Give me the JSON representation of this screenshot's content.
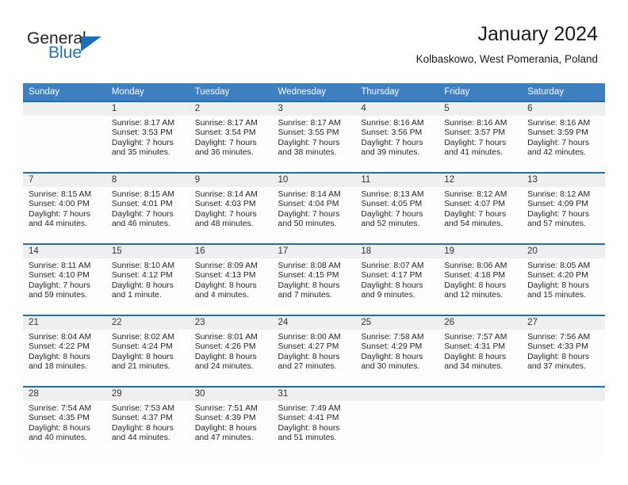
{
  "logo": {
    "word1": "General",
    "word2": "Blue",
    "triangle_color": "#1d70b8",
    "blue_color": "#1d76bd"
  },
  "header": {
    "month_title": "January 2024",
    "location": "Kolbaskowo, West Pomerania, Poland"
  },
  "theme": {
    "header_row_bg": "#3d7fc1",
    "week_separator": "#1d70b8",
    "daynum_band_bg": "#efefef",
    "cell_bg": "#fdfdfd"
  },
  "calendar": {
    "weekday_headers": [
      "Sunday",
      "Monday",
      "Tuesday",
      "Wednesday",
      "Thursday",
      "Friday",
      "Saturday"
    ],
    "weeks": [
      [
        {
          "day": "",
          "detail": ""
        },
        {
          "day": "1",
          "detail": "Sunrise: 8:17 AM\nSunset: 3:53 PM\nDaylight: 7 hours\nand 35 minutes."
        },
        {
          "day": "2",
          "detail": "Sunrise: 8:17 AM\nSunset: 3:54 PM\nDaylight: 7 hours\nand 36 minutes."
        },
        {
          "day": "3",
          "detail": "Sunrise: 8:17 AM\nSunset: 3:55 PM\nDaylight: 7 hours\nand 38 minutes."
        },
        {
          "day": "4",
          "detail": "Sunrise: 8:16 AM\nSunset: 3:56 PM\nDaylight: 7 hours\nand 39 minutes."
        },
        {
          "day": "5",
          "detail": "Sunrise: 8:16 AM\nSunset: 3:57 PM\nDaylight: 7 hours\nand 41 minutes."
        },
        {
          "day": "6",
          "detail": "Sunrise: 8:16 AM\nSunset: 3:59 PM\nDaylight: 7 hours\nand 42 minutes."
        }
      ],
      [
        {
          "day": "7",
          "detail": "Sunrise: 8:15 AM\nSunset: 4:00 PM\nDaylight: 7 hours\nand 44 minutes."
        },
        {
          "day": "8",
          "detail": "Sunrise: 8:15 AM\nSunset: 4:01 PM\nDaylight: 7 hours\nand 46 minutes."
        },
        {
          "day": "9",
          "detail": "Sunrise: 8:14 AM\nSunset: 4:03 PM\nDaylight: 7 hours\nand 48 minutes."
        },
        {
          "day": "10",
          "detail": "Sunrise: 8:14 AM\nSunset: 4:04 PM\nDaylight: 7 hours\nand 50 minutes."
        },
        {
          "day": "11",
          "detail": "Sunrise: 8:13 AM\nSunset: 4:05 PM\nDaylight: 7 hours\nand 52 minutes."
        },
        {
          "day": "12",
          "detail": "Sunrise: 8:12 AM\nSunset: 4:07 PM\nDaylight: 7 hours\nand 54 minutes."
        },
        {
          "day": "13",
          "detail": "Sunrise: 8:12 AM\nSunset: 4:09 PM\nDaylight: 7 hours\nand 57 minutes."
        }
      ],
      [
        {
          "day": "14",
          "detail": "Sunrise: 8:11 AM\nSunset: 4:10 PM\nDaylight: 7 hours\nand 59 minutes."
        },
        {
          "day": "15",
          "detail": "Sunrise: 8:10 AM\nSunset: 4:12 PM\nDaylight: 8 hours\nand 1 minute."
        },
        {
          "day": "16",
          "detail": "Sunrise: 8:09 AM\nSunset: 4:13 PM\nDaylight: 8 hours\nand 4 minutes."
        },
        {
          "day": "17",
          "detail": "Sunrise: 8:08 AM\nSunset: 4:15 PM\nDaylight: 8 hours\nand 7 minutes."
        },
        {
          "day": "18",
          "detail": "Sunrise: 8:07 AM\nSunset: 4:17 PM\nDaylight: 8 hours\nand 9 minutes."
        },
        {
          "day": "19",
          "detail": "Sunrise: 8:06 AM\nSunset: 4:18 PM\nDaylight: 8 hours\nand 12 minutes."
        },
        {
          "day": "20",
          "detail": "Sunrise: 8:05 AM\nSunset: 4:20 PM\nDaylight: 8 hours\nand 15 minutes."
        }
      ],
      [
        {
          "day": "21",
          "detail": "Sunrise: 8:04 AM\nSunset: 4:22 PM\nDaylight: 8 hours\nand 18 minutes."
        },
        {
          "day": "22",
          "detail": "Sunrise: 8:02 AM\nSunset: 4:24 PM\nDaylight: 8 hours\nand 21 minutes."
        },
        {
          "day": "23",
          "detail": "Sunrise: 8:01 AM\nSunset: 4:26 PM\nDaylight: 8 hours\nand 24 minutes."
        },
        {
          "day": "24",
          "detail": "Sunrise: 8:00 AM\nSunset: 4:27 PM\nDaylight: 8 hours\nand 27 minutes."
        },
        {
          "day": "25",
          "detail": "Sunrise: 7:58 AM\nSunset: 4:29 PM\nDaylight: 8 hours\nand 30 minutes."
        },
        {
          "day": "26",
          "detail": "Sunrise: 7:57 AM\nSunset: 4:31 PM\nDaylight: 8 hours\nand 34 minutes."
        },
        {
          "day": "27",
          "detail": "Sunrise: 7:56 AM\nSunset: 4:33 PM\nDaylight: 8 hours\nand 37 minutes."
        }
      ],
      [
        {
          "day": "28",
          "detail": "Sunrise: 7:54 AM\nSunset: 4:35 PM\nDaylight: 8 hours\nand 40 minutes."
        },
        {
          "day": "29",
          "detail": "Sunrise: 7:53 AM\nSunset: 4:37 PM\nDaylight: 8 hours\nand 44 minutes."
        },
        {
          "day": "30",
          "detail": "Sunrise: 7:51 AM\nSunset: 4:39 PM\nDaylight: 8 hours\nand 47 minutes."
        },
        {
          "day": "31",
          "detail": "Sunrise: 7:49 AM\nSunset: 4:41 PM\nDaylight: 8 hours\nand 51 minutes."
        },
        {
          "day": "",
          "detail": ""
        },
        {
          "day": "",
          "detail": ""
        },
        {
          "day": "",
          "detail": ""
        }
      ]
    ]
  }
}
